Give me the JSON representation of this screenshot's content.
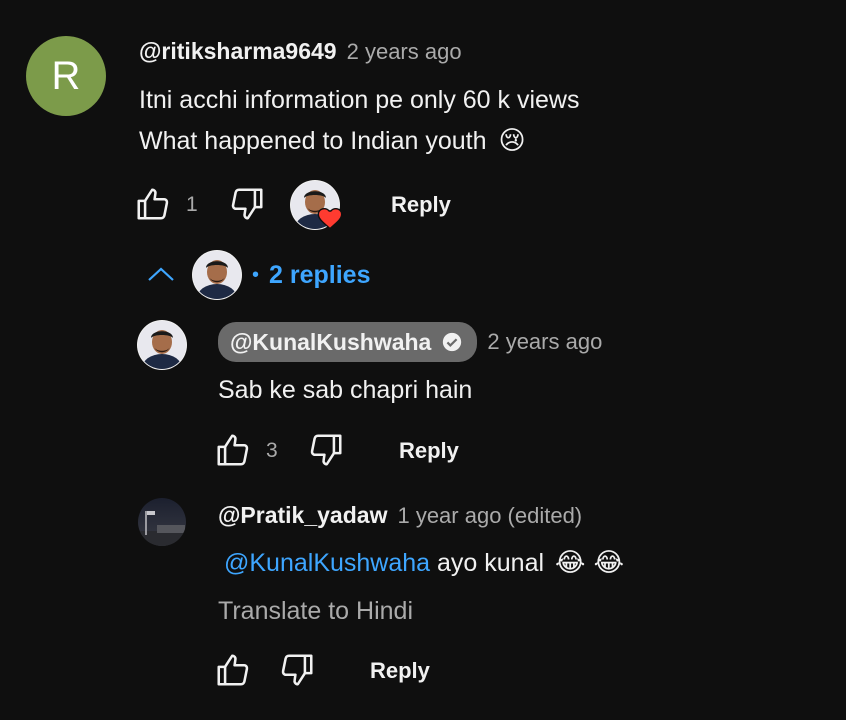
{
  "comment": {
    "avatar_letter": "R",
    "handle": "@ritiksharma9649",
    "time": "2 years ago",
    "line1": "Itni acchi information pe only 60 k views",
    "line2": "What happened to Indian youth",
    "line2_emoji": "😢",
    "likes": "1",
    "reply_label": "Reply"
  },
  "replies_toggle": {
    "label": "2 replies",
    "separator": "•"
  },
  "replies": [
    {
      "handle": "@KunalKushwaha",
      "verified": true,
      "time": "2 years ago",
      "text": "Sab ke sab chapri hain",
      "likes": "3",
      "reply_label": "Reply"
    },
    {
      "handle": "@Pratik_yadaw",
      "time": "1 year ago (edited)",
      "mention": "@KunalKushwaha",
      "text": " ayo kunal ",
      "emojis": "😂 😂",
      "translate": "Translate to Hindi",
      "reply_label": "Reply"
    }
  ],
  "colors": {
    "background": "#0f0f0f",
    "avatar_bg": "#7c9b4a",
    "link": "#3ea6ff",
    "heart": "#ff3b30",
    "chip": "#6a6a6a"
  }
}
